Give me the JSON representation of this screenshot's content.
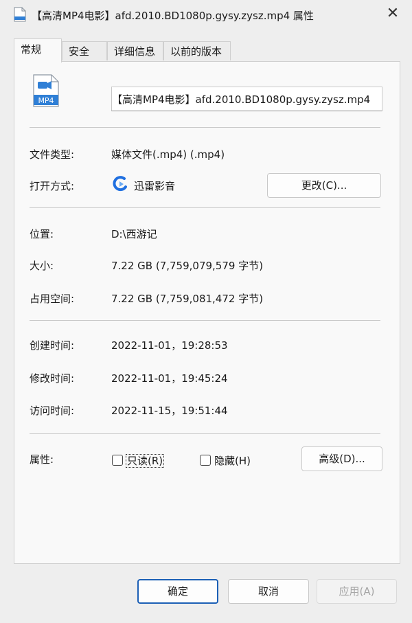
{
  "window": {
    "title": "【高清MP4电影】afd.2010.BD1080p.gysy.zysz.mp4 属性",
    "close_glyph": "✕"
  },
  "tabs": [
    {
      "label": "常规"
    },
    {
      "label": "安全"
    },
    {
      "label": "详细信息"
    },
    {
      "label": "以前的版本"
    }
  ],
  "general": {
    "icon_text": "MP4",
    "filename": "【高清MP4电影】afd.2010.BD1080p.gysy.zysz.mp4",
    "type_label": "文件类型:",
    "type_value": "媒体文件(.mp4) (.mp4)",
    "opens_label": "打开方式:",
    "opens_app": "迅雷影音",
    "change_button": "更改(C)...",
    "location_label": "位置:",
    "location_value": "D:\\西游记",
    "size_label": "大小:",
    "size_value": "7.22 GB (7,759,079,579 字节)",
    "disk_size_label": "占用空间:",
    "disk_size_value": "7.22 GB (7,759,081,472 字节)",
    "created_label": "创建时间:",
    "created_value": "2022-11-01，19:28:53",
    "modified_label": "修改时间:",
    "modified_value": "2022-11-01，19:45:24",
    "accessed_label": "访问时间:",
    "accessed_value": "2022-11-15，19:51:44",
    "attributes_label": "属性:",
    "readonly_label": "只读(R)",
    "hidden_label": "隐藏(H)",
    "advanced_button": "高级(D)..."
  },
  "footer": {
    "ok": "确定",
    "cancel": "取消",
    "apply": "应用(A)"
  },
  "colors": {
    "accent": "#1b5fb5",
    "file_icon": "#2f7fd6",
    "app_icon": "#1f6fe0"
  }
}
